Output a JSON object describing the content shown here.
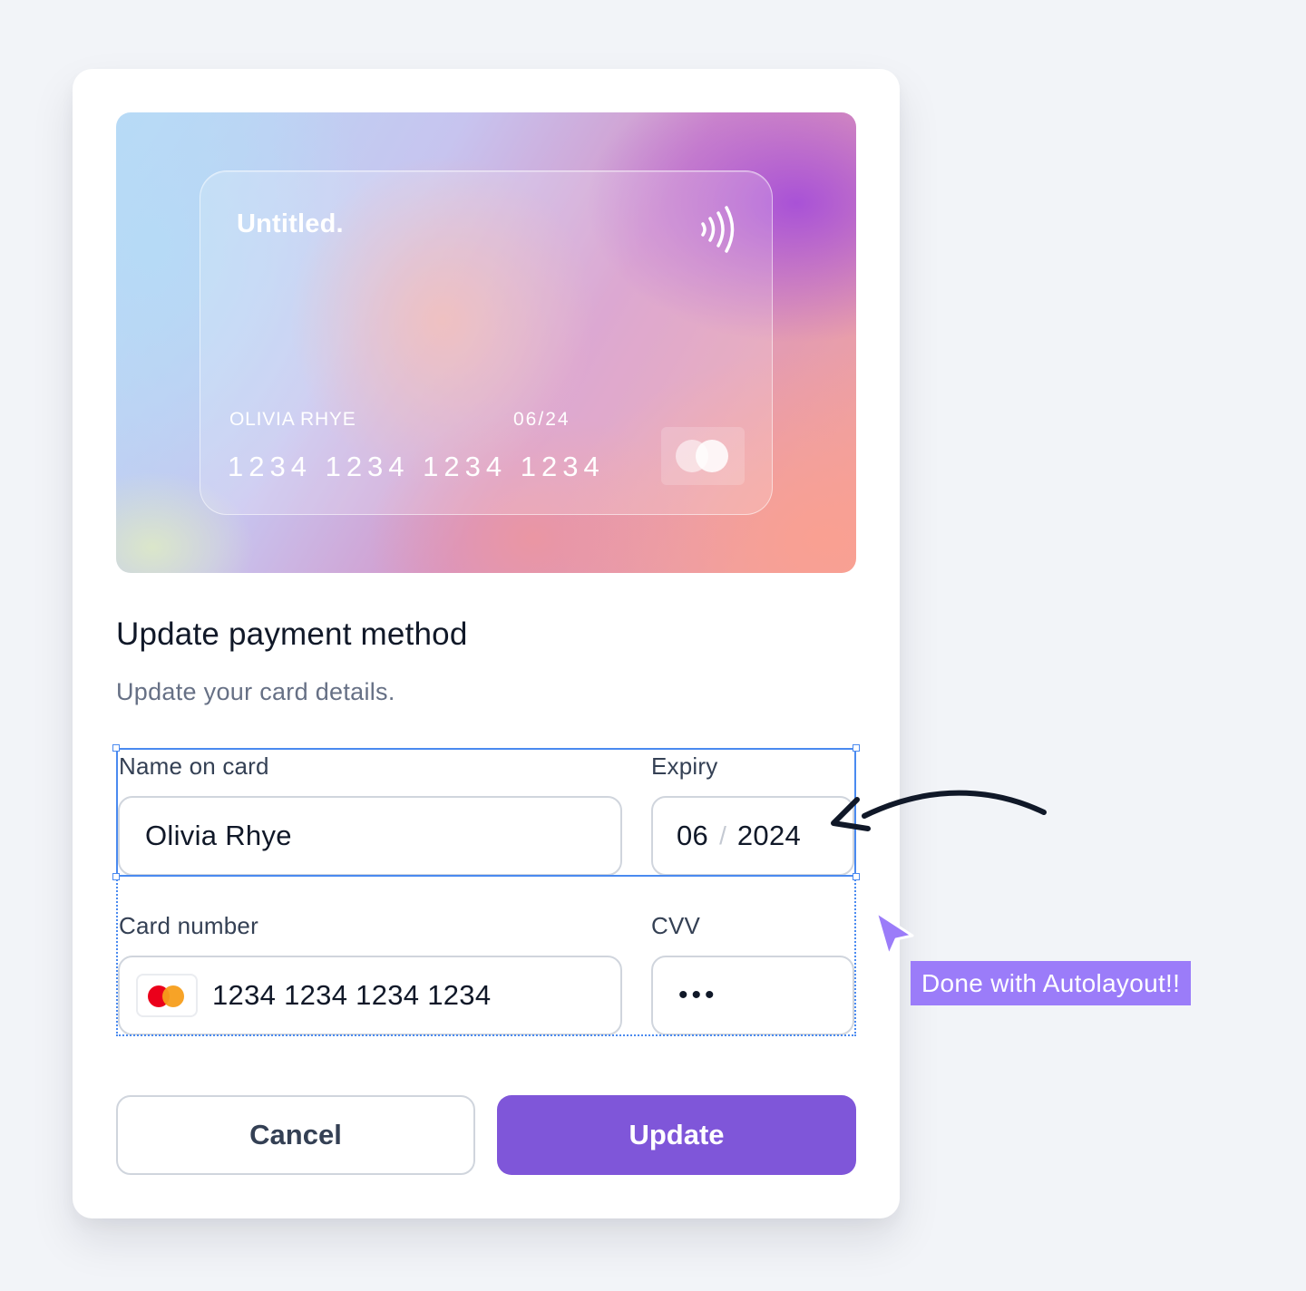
{
  "card_preview": {
    "brand": "Untitled.",
    "holder": "OLIVIA RHYE",
    "expiry": "06/24",
    "number": "1234 1234 1234 1234"
  },
  "dialog": {
    "title": "Update payment method",
    "subtitle": "Update your card details."
  },
  "form": {
    "name_label": "Name on card",
    "name_value": "Olivia Rhye",
    "expiry_label": "Expiry",
    "expiry_month": "06",
    "expiry_separator": "/",
    "expiry_year": "2024",
    "card_number_label": "Card number",
    "card_number_value": "1234 1234 1234 1234",
    "cvv_label": "CVV",
    "cvv_value": "•••"
  },
  "actions": {
    "cancel": "Cancel",
    "update": "Update"
  },
  "annotation": {
    "tooltip": "Done with Autolayout!!"
  },
  "colors": {
    "primary": "#7f56d9",
    "selection": "#4a8af0",
    "tooltip": "#9b7cf9",
    "mastercard_red": "#eb001b",
    "mastercard_orange": "#f79e1b"
  }
}
